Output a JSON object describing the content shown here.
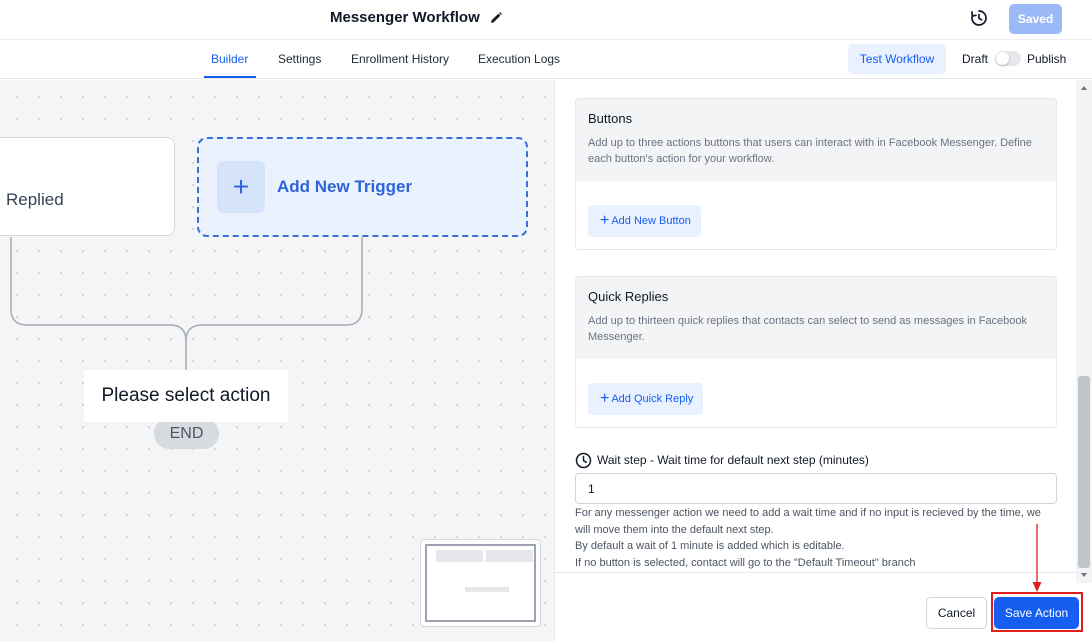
{
  "header": {
    "workflow_title": "Messenger Workflow",
    "saved_label": "Saved"
  },
  "nav": {
    "tabs": [
      {
        "label": "Builder",
        "active": true
      },
      {
        "label": "Settings",
        "active": false
      },
      {
        "label": "Enrollment History",
        "active": false
      },
      {
        "label": "Execution Logs",
        "active": false
      }
    ],
    "test_label": "Test Workflow",
    "draft_label": "Draft",
    "publish_label": "Publish",
    "published": false
  },
  "canvas": {
    "trigger_label": "Replied",
    "add_trigger_label": "Add New Trigger",
    "select_action_label": "Please select action",
    "end_label": "END"
  },
  "panel": {
    "buttons": {
      "title": "Buttons",
      "description": "Add up to three actions buttons that users can interact with in Facebook Messenger. Define each button's action for your workflow.",
      "add_label": "Add New Button"
    },
    "quick_replies": {
      "title": "Quick Replies",
      "description": "Add up to thirteen quick replies that contacts can select to send as messages in Facebook Messenger.",
      "add_label": "Add Quick Reply"
    },
    "wait": {
      "label": "Wait step - Wait time for default next step (minutes)",
      "value": "1",
      "help_lines": [
        "For any messenger action we need to add a wait time and if no input is recieved by the time, we will move them into the default next step.",
        "By default a wait of 1 minute is added which is editable.",
        "If no button is selected, contact will go to the \"Default Timeout\" branch"
      ]
    },
    "cancel_label": "Cancel",
    "save_label": "Save Action"
  },
  "colors": {
    "accent": "#155eef",
    "annotation": "#e11d1d",
    "saved_disabled": "#9bb9f6"
  }
}
